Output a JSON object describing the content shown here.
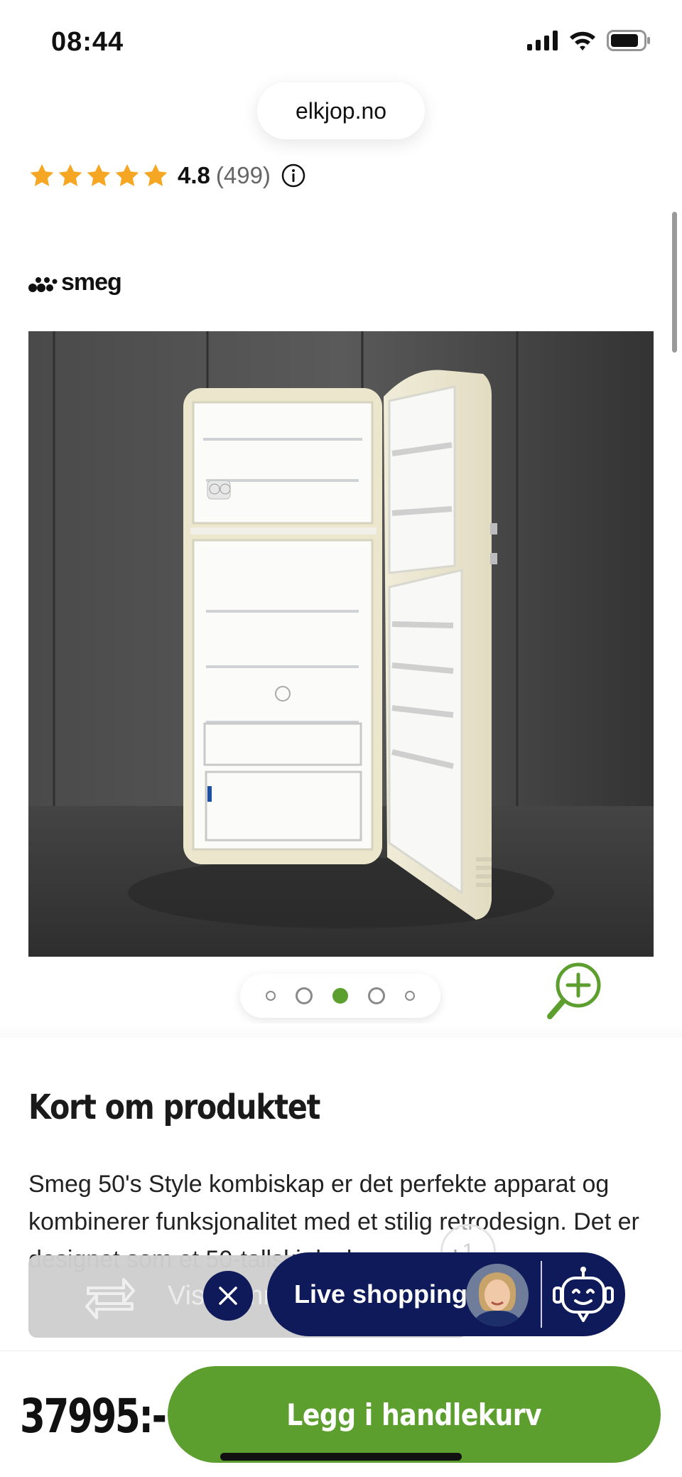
{
  "status_bar": {
    "time": "08:44"
  },
  "browser": {
    "url": "elkjop.no"
  },
  "rating": {
    "value": "4.8",
    "count": "(499)",
    "stars": 5,
    "star_color": "#f5a623"
  },
  "brand": {
    "name": "smeg"
  },
  "carousel": {
    "total": 5,
    "active_index": 2
  },
  "section": {
    "title": "Kort om produktet",
    "description": "Smeg 50's Style kombiskap er det perfekte apparat og kombinerer funksjonalitet med et stilig retrodesign. Det er designet som et 50-tallskjøleskap, men har"
  },
  "compare_banner": {
    "label": "Vis sammenligning"
  },
  "page_badge": "1",
  "live_shopping": {
    "label": "Live shopping"
  },
  "footer": {
    "price": "37995:-",
    "add_to_cart": "Legg i handlekurv"
  },
  "colors": {
    "accent_green": "#5c9f2f",
    "navy": "#0f1a5a"
  }
}
